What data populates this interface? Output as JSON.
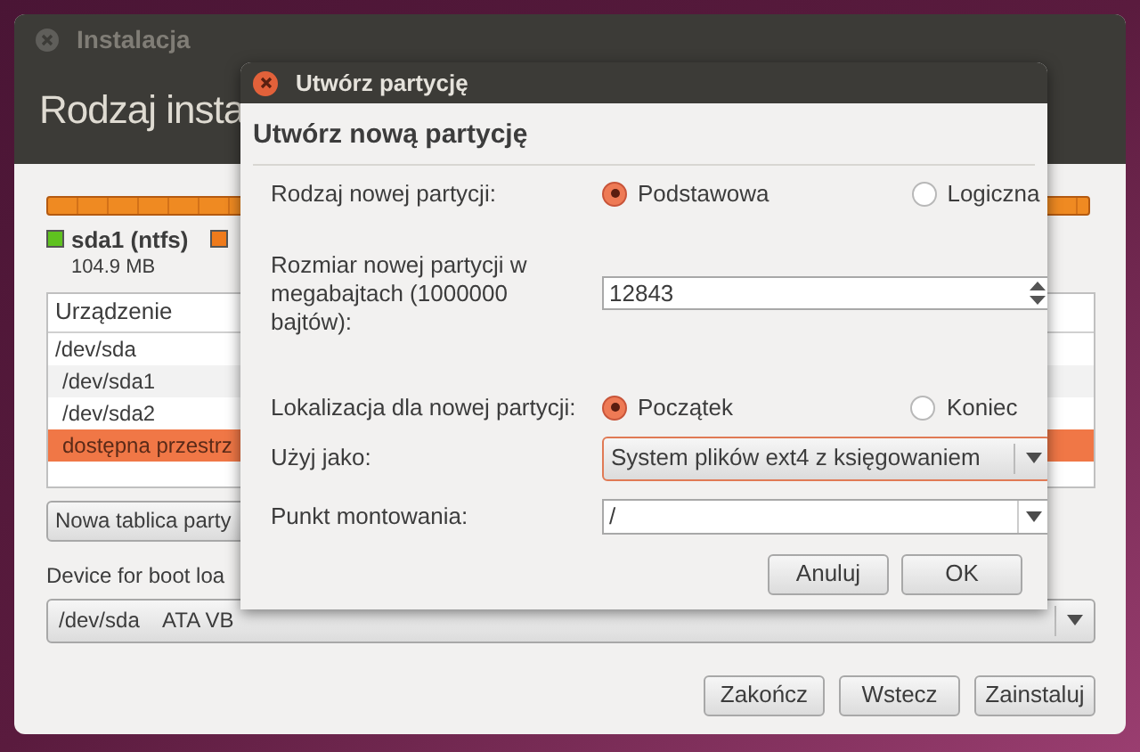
{
  "main_window": {
    "title": "Instalacja",
    "heading": "Rodzaj insta",
    "legend": [
      {
        "label": "sda1 (ntfs)",
        "size": "104.9 MB",
        "color": "#5fc21f"
      },
      {
        "color": "#ef7b1c"
      }
    ],
    "table": {
      "columns": [
        "Urządzenie"
      ],
      "rows": [
        {
          "cells": [
            "/dev/sda"
          ],
          "selected": false
        },
        {
          "cells": [
            "/dev/sda1"
          ],
          "selected": false
        },
        {
          "cells": [
            "/dev/sda2"
          ],
          "selected": false
        },
        {
          "cells": [
            "dostępna przestrz"
          ],
          "selected": true
        }
      ]
    },
    "new_table_button": "Nowa tablica party",
    "boot_loader": {
      "label": "Device for boot loa",
      "value": "/dev/sda    ATA VB"
    },
    "buttons": [
      "Zakończ",
      "Wstecz",
      "Zainstaluj"
    ]
  },
  "dialog": {
    "title": "Utwórz partycję",
    "heading": "Utwórz nową partycję",
    "type": {
      "label": "Rodzaj nowej partycji:",
      "options": [
        {
          "label": "Podstawowa",
          "selected": true
        },
        {
          "label": "Logiczna",
          "selected": false
        }
      ]
    },
    "size": {
      "label": "Rozmiar nowej partycji w megabajtach (1000000 bajtów):",
      "value": "12843"
    },
    "location": {
      "label": "Lokalizacja dla nowej partycji:",
      "options": [
        {
          "label": "Początek",
          "selected": true
        },
        {
          "label": "Koniec",
          "selected": false
        }
      ]
    },
    "use_as": {
      "label": "Użyj jako:",
      "value": "System plików ext4 z księgowaniem"
    },
    "mount_point": {
      "label": "Punkt montowania:",
      "value": "/"
    },
    "buttons": [
      "Anuluj",
      "OK"
    ]
  }
}
